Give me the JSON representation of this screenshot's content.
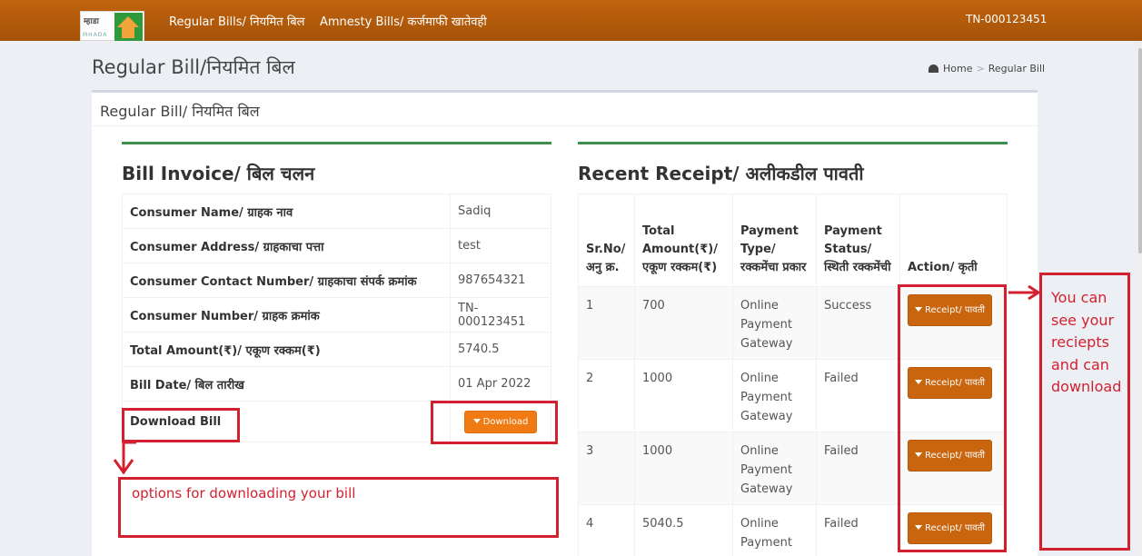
{
  "topbar": {
    "logo_text": "म्हाडा",
    "logo_sub": "MHADA",
    "nav": [
      "Regular Bills/ नियमित बिल",
      "Amnesty Bills/ कर्जमाफी खातेवही"
    ],
    "consumer_id": "TN-000123451"
  },
  "page": {
    "title": "Regular Bill/नियमित बिल",
    "breadcrumb": [
      "Home",
      "Regular Bill"
    ],
    "panel_title": "Regular Bill/ नियमित बिल"
  },
  "invoice": {
    "title": "Bill Invoice/ बिल चलन",
    "rows": [
      {
        "label": "Consumer Name/ ग्राहक नाव",
        "value": "Sadiq"
      },
      {
        "label": "Consumer Address/ ग्राहकाचा पत्ता",
        "value": "test"
      },
      {
        "label": "Consumer Contact Number/ ग्राहकाचा संपर्क क्रमांक",
        "value": "987654321"
      },
      {
        "label": "Consumer Number/ ग्राहक क्रमांक",
        "value": "TN-000123451"
      },
      {
        "label": "Total Amount(₹)/ एकूण रक्कम(₹)",
        "value": "5740.5"
      },
      {
        "label": "Bill Date/ बिल तारीख",
        "value": "01 Apr 2022"
      }
    ],
    "download_label": "Download Bill",
    "download_button": "Download"
  },
  "receipts": {
    "title": "Recent Receipt/ अलीकडील पावती",
    "headers": [
      "Sr.No/ अनु क्र.",
      "Total Amount(₹)/ एकूण रक्कम(₹)",
      "Payment Type/ रक्कमेंचा प्रकार",
      "Payment Status/ स्थिती रक्कमेंची",
      "Action/ कृती"
    ],
    "rows": [
      {
        "sr": "1",
        "amount": "700",
        "type": "Online Payment Gateway",
        "status": "Success",
        "action": "Receipt/ पावती"
      },
      {
        "sr": "2",
        "amount": "1000",
        "type": "Online Payment Gateway",
        "status": "Failed",
        "action": "Receipt/ पावती"
      },
      {
        "sr": "3",
        "amount": "1000",
        "type": "Online Payment Gateway",
        "status": "Failed",
        "action": "Receipt/ पावती"
      },
      {
        "sr": "4",
        "amount": "5040.5",
        "type": "Online Payment",
        "status": "Failed",
        "action": "Receipt/ पावती"
      }
    ]
  },
  "annotations": {
    "bill_note": "options for downloading your bill",
    "receipt_note": "You can see your reciepts and can download"
  },
  "colors": {
    "topbar": "#b35c0b",
    "accent_green": "#3d8f4d",
    "download_btn": "#f07b12",
    "receipt_btn": "#c9650d",
    "annotation_red": "#d32030"
  }
}
